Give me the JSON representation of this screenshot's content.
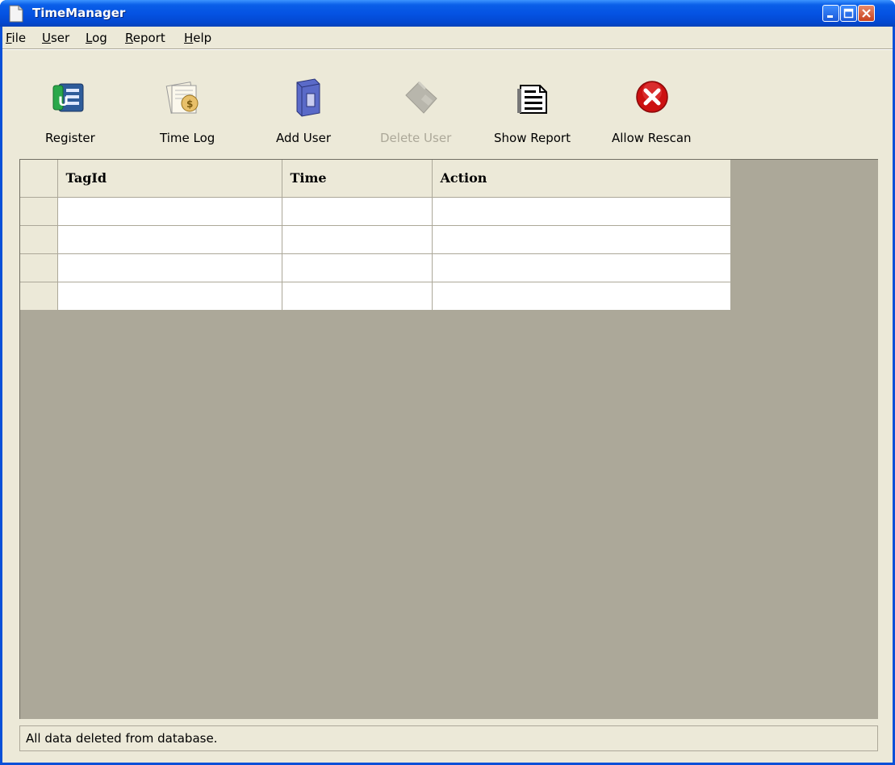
{
  "window": {
    "title": "TimeManager",
    "icon": "document-icon"
  },
  "titlebar_controls": {
    "minimize_icon": "minimize-icon",
    "maximize_icon": "maximize-icon",
    "close_icon": "close-icon"
  },
  "menu": {
    "items": [
      {
        "label": "File",
        "mnemonic": "F"
      },
      {
        "label": "User",
        "mnemonic": "U"
      },
      {
        "label": "Log",
        "mnemonic": "L"
      },
      {
        "label": "Report",
        "mnemonic": "R"
      },
      {
        "label": "Help",
        "mnemonic": "H"
      }
    ]
  },
  "toolbar": {
    "buttons": [
      {
        "label": "Register",
        "icon": "register-card-icon",
        "enabled": true
      },
      {
        "label": "Time Log",
        "icon": "time-log-icon",
        "enabled": true
      },
      {
        "label": "Add User",
        "icon": "add-user-book-icon",
        "enabled": true
      },
      {
        "label": "Delete User",
        "icon": "delete-user-icon",
        "enabled": false
      },
      {
        "label": "Show Report",
        "icon": "report-document-icon",
        "enabled": true
      },
      {
        "label": "Allow Rescan",
        "icon": "red-x-icon",
        "enabled": true
      }
    ]
  },
  "grid": {
    "columns": [
      "TagId",
      "Time",
      "Action"
    ],
    "rows": [
      [
        "",
        "",
        ""
      ],
      [
        "",
        "",
        ""
      ],
      [
        "",
        "",
        ""
      ],
      [
        "",
        "",
        ""
      ]
    ]
  },
  "status": {
    "text": "All data deleted from database."
  },
  "colors": {
    "titlebar": "#0553e3",
    "window_bg": "#ece9d8",
    "grid_bg": "#aca899",
    "close_button": "#c8421e",
    "allow_rescan_icon": "#cc1111"
  }
}
